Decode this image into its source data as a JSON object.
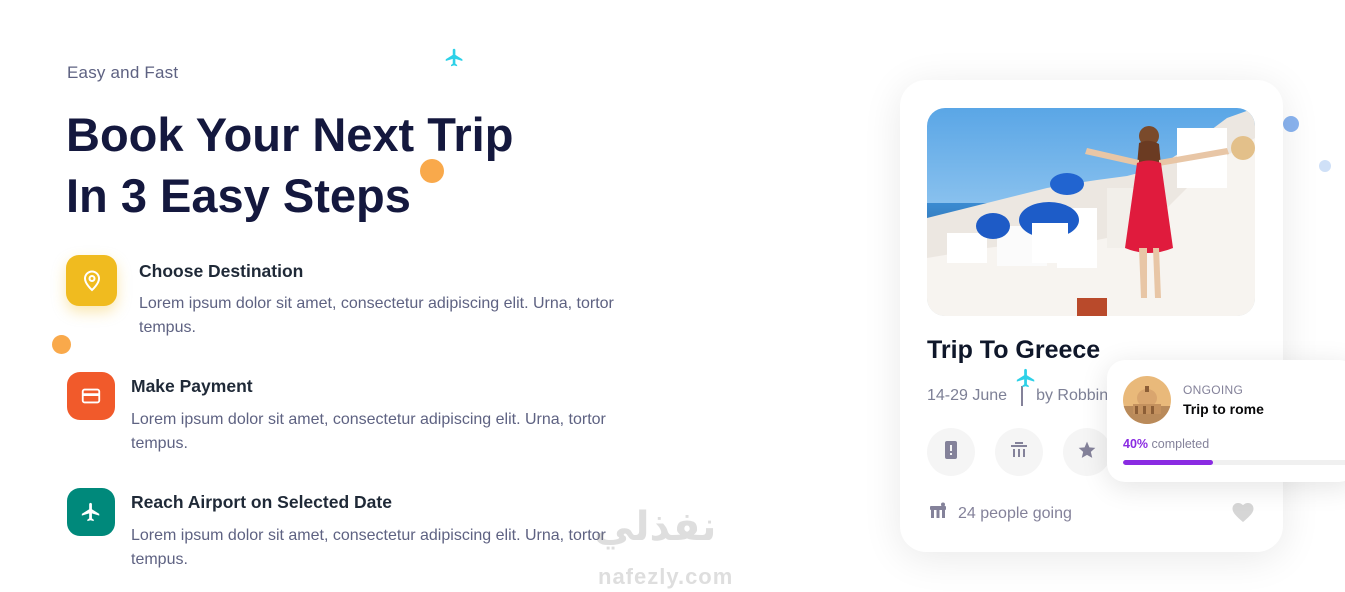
{
  "hero": {
    "eyebrow": "Easy and Fast",
    "title_line1": "Book Your Next Trip",
    "title_line2": "In 3 Easy Steps"
  },
  "steps": [
    {
      "title": "Choose Destination",
      "description": "Lorem ipsum dolor sit amet, consectetur adipiscing elit. Urna, tortor tempus.",
      "icon": "location-pin-icon",
      "color": "#f0bb1f"
    },
    {
      "title": "Make Payment",
      "description": "Lorem ipsum dolor sit amet, consectetur adipiscing elit. Urna, tortor tempus.",
      "icon": "credit-card-icon",
      "color": "#f15a2b"
    },
    {
      "title": "Reach Airport on Selected Date",
      "description": "Lorem ipsum dolor sit amet, consectetur adipiscing elit. Urna, tortor tempus.",
      "icon": "airplane-icon",
      "color": "#006380"
    }
  ],
  "trip_card": {
    "title": "Trip To Greece",
    "dates": "14-29 June",
    "author": "by Robbin j",
    "people": "24 people going",
    "actions": [
      "leaf-icon",
      "map-icon",
      "send-icon"
    ]
  },
  "ongoing": {
    "status": "ONGOING",
    "name": "Trip to rome",
    "percent_label": "40%",
    "completed_label": "completed",
    "progress": 0.4
  },
  "watermark": {
    "arabic": "نفذلي",
    "latin": "nafezly.com"
  },
  "colors": {
    "heading": "#14183e",
    "body": "#5e6282",
    "accent_purple": "#8a2be2",
    "deco_cyan": "#2dd1e8",
    "deco_orange": "#f9a94b"
  }
}
